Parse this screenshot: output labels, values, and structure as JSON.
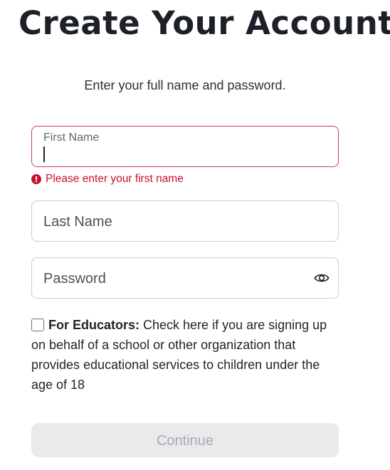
{
  "header": {
    "title": "Create Your Account",
    "subtitle": "Enter your full name and password."
  },
  "form": {
    "first_name": {
      "label": "First Name",
      "value": "",
      "error": "Please enter your first name",
      "state": "error-focused"
    },
    "last_name": {
      "placeholder": "Last Name",
      "value": ""
    },
    "password": {
      "placeholder": "Password",
      "value": "",
      "toggle_icon": "eye-icon"
    },
    "educator": {
      "checked": false,
      "bold_label": "For Educators:",
      "text": " Check here if you are signing up on behalf of a school or other organization that provides educational services to children under the age of 18"
    },
    "continue_label": "Continue"
  },
  "colors": {
    "error": "#c8102e",
    "border": "#c9ccd1",
    "button_disabled_bg": "#e9eaec",
    "button_disabled_text": "#a6aab0"
  }
}
